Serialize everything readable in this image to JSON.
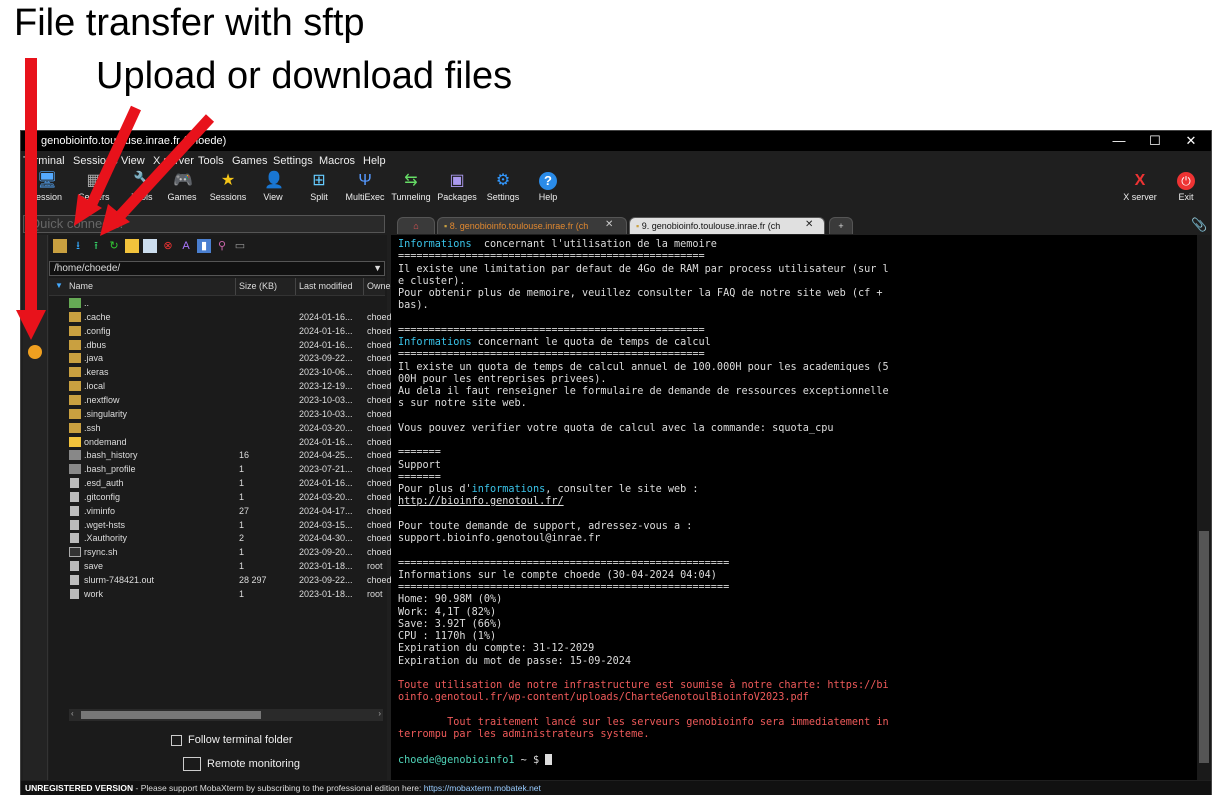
{
  "annotations": {
    "title": "File transfer with sftp",
    "subtitle": "Upload or download files"
  },
  "window": {
    "title": "genobioinfo.toulouse.inrae.fr (choede)",
    "controls": [
      "—",
      "☐",
      "✕"
    ]
  },
  "menu": [
    "Terminal",
    "Sessions",
    "View",
    "X server",
    "Tools",
    "Games",
    "Settings",
    "Macros",
    "Help"
  ],
  "toolbar": [
    {
      "label": "Session",
      "icon": "session-icon",
      "glyph": "🖥"
    },
    {
      "label": "Servers",
      "icon": "servers-icon",
      "glyph": "▦"
    },
    {
      "label": "Tools",
      "icon": "tools-icon",
      "glyph": "🔧"
    },
    {
      "label": "Games",
      "icon": "gamepad-icon",
      "glyph": "🎮"
    },
    {
      "label": "Sessions",
      "icon": "star-icon",
      "glyph": "★"
    },
    {
      "label": "View",
      "icon": "view-icon",
      "glyph": "👤"
    },
    {
      "label": "Split",
      "icon": "split-icon",
      "glyph": "⊞"
    },
    {
      "label": "MultiExec",
      "icon": "multiexec-icon",
      "glyph": "Ψ"
    },
    {
      "label": "Tunneling",
      "icon": "tunneling-icon",
      "glyph": "⇆"
    },
    {
      "label": "Packages",
      "icon": "packages-icon",
      "glyph": "▣"
    },
    {
      "label": "Settings",
      "icon": "settings-icon",
      "glyph": "⚙"
    },
    {
      "label": "Help",
      "icon": "help-icon",
      "glyph": "?"
    }
  ],
  "toolbar_right": [
    {
      "label": "X server",
      "icon": "x-server-icon",
      "glyph": "X"
    },
    {
      "label": "Exit",
      "icon": "exit-icon",
      "glyph": "⏻"
    }
  ],
  "quick_connect": {
    "placeholder": "Quick connect..."
  },
  "sftp": {
    "path": "/home/choede/",
    "columns": [
      "Name",
      "Size (KB)",
      "Last modified",
      "Owner"
    ],
    "files": [
      {
        "name": "..",
        "size": "",
        "modified": "",
        "owner": "",
        "kind": "up"
      },
      {
        "name": ".cache",
        "size": "",
        "modified": "2024-01-16...",
        "owner": "choede",
        "kind": "folder"
      },
      {
        "name": ".config",
        "size": "",
        "modified": "2024-01-16...",
        "owner": "choede",
        "kind": "folder"
      },
      {
        "name": ".dbus",
        "size": "",
        "modified": "2024-01-16...",
        "owner": "choede",
        "kind": "folder"
      },
      {
        "name": ".java",
        "size": "",
        "modified": "2023-09-22...",
        "owner": "choede",
        "kind": "folder"
      },
      {
        "name": ".keras",
        "size": "",
        "modified": "2023-10-06...",
        "owner": "choede",
        "kind": "folder"
      },
      {
        "name": ".local",
        "size": "",
        "modified": "2023-12-19...",
        "owner": "choede",
        "kind": "folder"
      },
      {
        "name": ".nextflow",
        "size": "",
        "modified": "2023-10-03...",
        "owner": "choede",
        "kind": "folder"
      },
      {
        "name": ".singularity",
        "size": "",
        "modified": "2023-10-03...",
        "owner": "choede",
        "kind": "folder"
      },
      {
        "name": ".ssh",
        "size": "",
        "modified": "2024-03-20...",
        "owner": "choede",
        "kind": "folder"
      },
      {
        "name": "ondemand",
        "size": "",
        "modified": "2024-01-16...",
        "owner": "choede",
        "kind": "folderb"
      },
      {
        "name": ".bash_history",
        "size": "16",
        "modified": "2024-04-25...",
        "owner": "choede",
        "kind": "file"
      },
      {
        "name": ".bash_profile",
        "size": "1",
        "modified": "2023-07-21...",
        "owner": "choede",
        "kind": "file"
      },
      {
        "name": ".esd_auth",
        "size": "1",
        "modified": "2024-01-16...",
        "owner": "choede",
        "kind": "doc"
      },
      {
        "name": ".gitconfig",
        "size": "1",
        "modified": "2024-03-20...",
        "owner": "choede",
        "kind": "doc"
      },
      {
        "name": ".viminfo",
        "size": "27",
        "modified": "2024-04-17...",
        "owner": "choede",
        "kind": "doc"
      },
      {
        "name": ".wget-hsts",
        "size": "1",
        "modified": "2024-03-15...",
        "owner": "choede",
        "kind": "doc"
      },
      {
        "name": ".Xauthority",
        "size": "2",
        "modified": "2024-04-30...",
        "owner": "choede",
        "kind": "doc"
      },
      {
        "name": "rsync.sh",
        "size": "1",
        "modified": "2023-09-20...",
        "owner": "choede",
        "kind": "sh"
      },
      {
        "name": "save",
        "size": "1",
        "modified": "2023-01-18...",
        "owner": "root",
        "kind": "doc"
      },
      {
        "name": "slurm-748421.out",
        "size": "28 297",
        "modified": "2023-09-22...",
        "owner": "choede",
        "kind": "doc"
      },
      {
        "name": "work",
        "size": "1",
        "modified": "2023-01-18...",
        "owner": "root",
        "kind": "doc"
      }
    ],
    "follow_label": "Follow terminal folder",
    "remote_label": "Remote monitoring"
  },
  "tabs": [
    {
      "label": "8. genobioinfo.toulouse.inrae.fr (ch",
      "active": false
    },
    {
      "label": "9. genobioinfo.toulouse.inrae.fr (ch",
      "active": true
    }
  ],
  "terminal": [
    [
      [
        "cy",
        "Informations"
      ],
      [
        "",
        "  concernant l'utilisation de la memoire"
      ]
    ],
    [
      [
        "",
        "=================================================="
      ]
    ],
    [
      [
        "",
        "Il existe une limitation par defaut de 4Go de RAM par process utilisateur (sur l"
      ]
    ],
    [
      [
        "",
        "e cluster)."
      ]
    ],
    [
      [
        "",
        "Pour obtenir plus de memoire, veuillez consulter la FAQ de notre site web (cf +"
      ]
    ],
    [
      [
        "",
        "bas)."
      ]
    ],
    [
      [
        "",
        ""
      ]
    ],
    [
      [
        "",
        "=================================================="
      ]
    ],
    [
      [
        "cy",
        "Informations"
      ],
      [
        "",
        " concernant le quota de temps de calcul"
      ]
    ],
    [
      [
        "",
        "=================================================="
      ]
    ],
    [
      [
        "",
        "Il existe un quota de temps de calcul annuel de 100.000H pour les academiques (5"
      ]
    ],
    [
      [
        "",
        "00H pour les entreprises privees)."
      ]
    ],
    [
      [
        "",
        "Au dela il faut renseigner le formulaire de demande de ressources exceptionnelle"
      ]
    ],
    [
      [
        "",
        "s sur notre site web."
      ]
    ],
    [
      [
        "",
        ""
      ]
    ],
    [
      [
        "",
        "Vous pouvez verifier votre quota de calcul avec la commande: squota_cpu"
      ]
    ],
    [
      [
        "",
        ""
      ]
    ],
    [
      [
        "",
        "======="
      ]
    ],
    [
      [
        "",
        "Support"
      ]
    ],
    [
      [
        "",
        "======="
      ]
    ],
    [
      [
        "",
        "Pour plus d'"
      ],
      [
        "cy",
        "informations"
      ],
      [
        "",
        ", consulter le site web :"
      ]
    ],
    [
      [
        "ul",
        "http://bioinfo.genotoul.fr/"
      ]
    ],
    [
      [
        "",
        ""
      ]
    ],
    [
      [
        "",
        "Pour toute demande de support, adressez-vous a :"
      ]
    ],
    [
      [
        "",
        "support.bioinfo.genotoul@inrae.fr"
      ]
    ],
    [
      [
        "",
        ""
      ]
    ],
    [
      [
        "",
        "======================================================"
      ]
    ],
    [
      [
        "",
        "Informations sur le compte choede (30-04-2024 04:04)"
      ]
    ],
    [
      [
        "",
        "======================================================"
      ]
    ],
    [
      [
        "",
        "Home: 90.98M (0%)"
      ]
    ],
    [
      [
        "",
        "Work: 4,1T (82%)"
      ]
    ],
    [
      [
        "",
        "Save: 3.92T (66%)"
      ]
    ],
    [
      [
        "",
        "CPU : 1170h (1%)"
      ]
    ],
    [
      [
        "",
        "Expiration du compte: 31-12-2029"
      ]
    ],
    [
      [
        "",
        "Expiration du mot de passe: 15-09-2024"
      ]
    ],
    [
      [
        "",
        ""
      ]
    ],
    [
      [
        "rd",
        "Toute utilisation de notre infrastructure est soumise à notre charte: https://bi"
      ]
    ],
    [
      [
        "rd",
        "oinfo.genotoul.fr/wp-content/uploads/CharteGenotoulBioinfoV2023.pdf"
      ]
    ],
    [
      [
        "",
        ""
      ]
    ],
    [
      [
        "rd",
        "        Tout traitement lancé sur les serveurs genobioinfo sera immediatement in"
      ]
    ],
    [
      [
        "rd",
        "terrompu par les administrateurs systeme."
      ]
    ],
    [
      [
        "",
        ""
      ]
    ],
    [
      [
        "gn",
        "choede@genobioinfo1"
      ],
      [
        "",
        " ~ $ "
      ],
      [
        "cursor",
        ""
      ]
    ]
  ],
  "status": {
    "bold": "UNREGISTERED VERSION",
    "text": "  -  Please support MobaXterm by subscribing to the professional edition here:  ",
    "link": "https://mobaxterm.mobatek.net"
  }
}
